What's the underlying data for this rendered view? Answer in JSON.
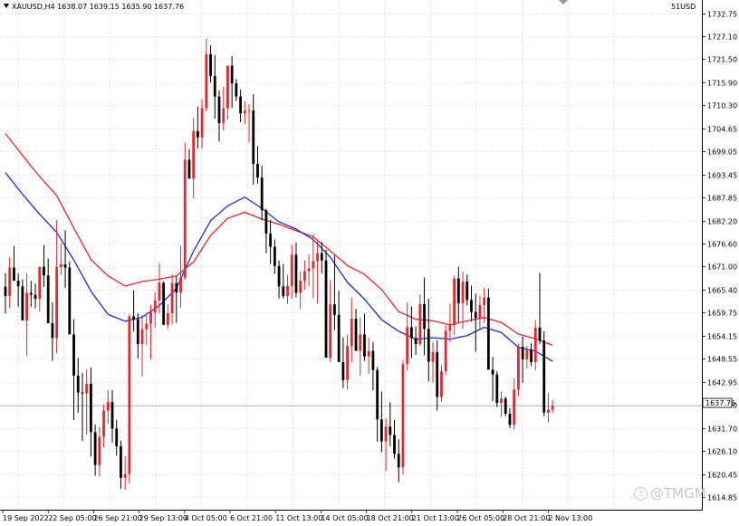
{
  "header": {
    "symbol_line": "XAUUSD,H4  1638.07 1639.15 1635.90 1637.76",
    "corner_label": "51USD"
  },
  "watermark": "@TMGM",
  "colors": {
    "up_candle": "#e8262b",
    "down_candle": "#000000",
    "ma_fast": "#1f2bd6",
    "ma_slow": "#e8262b",
    "grid": "#c8c8c8",
    "current_price_line": "#b0b0b0"
  },
  "chart_data": {
    "type": "candlestick",
    "grid": true,
    "ylim": [
      1615.0,
      1735.5
    ],
    "yticks": [
      "1732.75",
      "1727.10",
      "1721.50",
      "1715.90",
      "1710.30",
      "1704.65",
      "1699.05",
      "1693.45",
      "1687.85",
      "1682.20",
      "1676.60",
      "1671.00",
      "1665.40",
      "1659.75",
      "1654.15",
      "1648.55",
      "1642.95",
      "1637.30",
      "1631.70",
      "1626.10",
      "1620.45",
      "1614.85"
    ],
    "current_price": "1637.76",
    "xticks": [
      "19 Sep 2022",
      "22 Sep 05:00",
      "26 Sep 21:00",
      "29 Sep 13:00",
      "4 Oct 05:00",
      "6 Oct 21:00",
      "11 Oct 13:00",
      "14 Oct 05:00",
      "18 Oct 21:00",
      "21 Oct 13:00",
      "26 Oct 05:00",
      "28 Oct 21:00",
      "2 Nov 13:00"
    ],
    "candles_ohlc": [
      [
        1667.5,
        1670.9,
        1660.8,
        1665.2
      ],
      [
        1665.2,
        1674.9,
        1662.1,
        1672.3
      ],
      [
        1672.3,
        1677.7,
        1669.6,
        1669.0
      ],
      [
        1669.0,
        1670.8,
        1662.5,
        1667.6
      ],
      [
        1667.6,
        1669.3,
        1660.6,
        1659.1
      ],
      [
        1659.1,
        1670.9,
        1650.3,
        1666.0
      ],
      [
        1666.0,
        1669.0,
        1662.5,
        1665.5
      ],
      [
        1665.5,
        1668.3,
        1662.1,
        1664.5
      ],
      [
        1664.5,
        1671.4,
        1661.4,
        1672.5
      ],
      [
        1672.5,
        1677.9,
        1667.5,
        1670.3
      ],
      [
        1670.3,
        1674.6,
        1661.3,
        1658.4
      ],
      [
        1658.4,
        1663.6,
        1649.0,
        1654.7
      ],
      [
        1654.7,
        1684.2,
        1650.9,
        1672.4
      ],
      [
        1672.4,
        1678.4,
        1670.4,
        1673.1
      ],
      [
        1673.1,
        1681.6,
        1667.2,
        1672.3
      ],
      [
        1672.3,
        1673.8,
        1658.1,
        1655.6
      ],
      [
        1655.6,
        1659.4,
        1634.2,
        1645.3
      ],
      [
        1645.3,
        1649.7,
        1636.0,
        1641.1
      ],
      [
        1641.1,
        1646.0,
        1629.0,
        1640.9
      ],
      [
        1640.9,
        1646.9,
        1630.6,
        1643.3
      ],
      [
        1643.3,
        1647.3,
        1625.1,
        1631.2
      ],
      [
        1631.2,
        1633.1,
        1620.3,
        1623.0
      ],
      [
        1623.0,
        1632.5,
        1620.1,
        1630.0
      ],
      [
        1630.0,
        1638.1,
        1627.4,
        1636.6
      ],
      [
        1636.6,
        1641.7,
        1633.3,
        1638.7
      ],
      [
        1638.7,
        1641.7,
        1628.6,
        1632.1
      ],
      [
        1632.1,
        1634.3,
        1625.4,
        1627.7
      ],
      [
        1627.7,
        1629.1,
        1617.1,
        1619.8
      ],
      [
        1619.8,
        1625.2,
        1616.8,
        1620.7
      ],
      [
        1620.7,
        1660.7,
        1618.4,
        1660.1
      ],
      [
        1660.1,
        1666.6,
        1656.3,
        1659.4
      ],
      [
        1659.4,
        1660.9,
        1649.6,
        1653.2
      ],
      [
        1653.2,
        1660.4,
        1645.1,
        1656.9
      ],
      [
        1656.9,
        1661.0,
        1653.0,
        1658.3
      ],
      [
        1658.3,
        1663.0,
        1649.4,
        1661.1
      ],
      [
        1661.1,
        1666.1,
        1657.4,
        1664.1
      ],
      [
        1664.1,
        1673.5,
        1660.9,
        1668.5
      ],
      [
        1668.5,
        1668.8,
        1660.1,
        1658.0
      ],
      [
        1658.0,
        1663.2,
        1657.0,
        1660.9
      ],
      [
        1660.9,
        1670.6,
        1658.1,
        1668.4
      ],
      [
        1668.4,
        1670.1,
        1658.5,
        1666.1
      ],
      [
        1666.1,
        1677.8,
        1662.3,
        1669.8
      ],
      [
        1669.8,
        1703.5,
        1669.2,
        1699.2
      ],
      [
        1699.2,
        1701.9,
        1697.8,
        1694.5
      ],
      [
        1694.5,
        1709.6,
        1689.6,
        1706.4
      ],
      [
        1706.4,
        1712.5,
        1702.1,
        1704.8
      ],
      [
        1704.8,
        1714.3,
        1702.0,
        1712.1
      ],
      [
        1712.1,
        1729.5,
        1711.3,
        1725.6
      ],
      [
        1725.6,
        1727.8,
        1718.5,
        1720.1
      ],
      [
        1720.1,
        1725.4,
        1709.5,
        1715.0
      ],
      [
        1715.0,
        1716.6,
        1703.7,
        1708.4
      ],
      [
        1708.4,
        1717.4,
        1706.6,
        1712.1
      ],
      [
        1712.1,
        1722.1,
        1709.2,
        1722.7
      ],
      [
        1722.7,
        1725.1,
        1712.2,
        1718.3
      ],
      [
        1718.3,
        1719.4,
        1713.9,
        1715.0
      ],
      [
        1715.0,
        1716.7,
        1708.6,
        1710.8
      ],
      [
        1710.8,
        1713.8,
        1708.1,
        1711.5
      ],
      [
        1711.5,
        1713.1,
        1703.6,
        1711.5
      ],
      [
        1711.5,
        1715.6,
        1693.0,
        1698.2
      ],
      [
        1698.2,
        1702.6,
        1693.2,
        1694.8
      ],
      [
        1694.8,
        1697.8,
        1684.1,
        1686.6
      ],
      [
        1686.6,
        1687.0,
        1675.9,
        1680.8
      ],
      [
        1680.8,
        1684.2,
        1673.2,
        1677.5
      ],
      [
        1677.5,
        1679.3,
        1670.7,
        1672.7
      ],
      [
        1672.7,
        1674.1,
        1664.6,
        1667.6
      ],
      [
        1667.6,
        1673.2,
        1664.6,
        1665.2
      ],
      [
        1665.2,
        1670.5,
        1663.1,
        1667.7
      ],
      [
        1667.7,
        1678.0,
        1664.5,
        1675.5
      ],
      [
        1675.5,
        1678.5,
        1664.9,
        1666.0
      ],
      [
        1666.0,
        1671.3,
        1662.0,
        1669.0
      ],
      [
        1669.0,
        1674.1,
        1666.8,
        1671.4
      ],
      [
        1671.4,
        1675.5,
        1667.7,
        1672.1
      ],
      [
        1672.1,
        1680.6,
        1664.6,
        1673.9
      ],
      [
        1673.9,
        1678.8,
        1663.3,
        1675.9
      ],
      [
        1675.9,
        1678.7,
        1670.8,
        1674.1
      ],
      [
        1674.1,
        1676.8,
        1660.5,
        1649.8
      ],
      [
        1649.8,
        1669.2,
        1648.8,
        1663.1
      ],
      [
        1663.1,
        1675.3,
        1656.7,
        1660.5
      ],
      [
        1660.5,
        1666.5,
        1652.6,
        1648.7
      ],
      [
        1648.7,
        1654.9,
        1642.2,
        1644.2
      ],
      [
        1644.2,
        1655.5,
        1641.8,
        1652.7
      ],
      [
        1652.7,
        1664.8,
        1648.6,
        1659.5
      ],
      [
        1659.5,
        1662.0,
        1652.4,
        1651.5
      ],
      [
        1651.5,
        1659.8,
        1645.3,
        1655.6
      ],
      [
        1655.6,
        1660.8,
        1649.0,
        1650.1
      ],
      [
        1650.1,
        1654.8,
        1645.8,
        1651.5
      ],
      [
        1651.5,
        1653.7,
        1641.6,
        1646.7
      ],
      [
        1646.7,
        1647.5,
        1628.8,
        1634.4
      ],
      [
        1634.4,
        1641.3,
        1626.2,
        1628.9
      ],
      [
        1628.9,
        1634.7,
        1621.4,
        1632.6
      ],
      [
        1632.6,
        1638.7,
        1627.7,
        1630.5
      ],
      [
        1630.5,
        1634.3,
        1624.6,
        1625.8
      ],
      [
        1625.8,
        1629.4,
        1618.7,
        1622.4
      ],
      [
        1622.4,
        1649.2,
        1620.6,
        1648.2
      ],
      [
        1648.2,
        1663.6,
        1646.6,
        1657.4
      ],
      [
        1657.4,
        1662.6,
        1649.7,
        1654.7
      ],
      [
        1654.7,
        1657.6,
        1650.5,
        1653.2
      ],
      [
        1653.2,
        1665.6,
        1652.7,
        1663.2
      ],
      [
        1663.2,
        1669.8,
        1650.4,
        1657.0
      ],
      [
        1657.0,
        1664.5,
        1643.9,
        1648.8
      ],
      [
        1648.8,
        1653.6,
        1643.6,
        1651.2
      ],
      [
        1651.2,
        1654.2,
        1636.6,
        1640.0
      ],
      [
        1640.0,
        1647.9,
        1638.8,
        1646.4
      ],
      [
        1646.4,
        1657.9,
        1645.4,
        1656.5
      ],
      [
        1656.5,
        1663.3,
        1653.7,
        1657.9
      ],
      [
        1657.9,
        1670.3,
        1655.5,
        1669.6
      ],
      [
        1669.6,
        1672.5,
        1658.7,
        1663.4
      ],
      [
        1663.4,
        1671.3,
        1657.0,
        1668.8
      ],
      [
        1668.8,
        1670.6,
        1662.8,
        1664.2
      ],
      [
        1664.2,
        1667.8,
        1658.8,
        1661.2
      ],
      [
        1661.2,
        1665.8,
        1651.3,
        1659.7
      ],
      [
        1659.7,
        1665.3,
        1656.6,
        1662.9
      ],
      [
        1662.9,
        1667.3,
        1658.5,
        1664.8
      ],
      [
        1664.8,
        1667.0,
        1650.7,
        1646.8
      ],
      [
        1646.8,
        1650.0,
        1638.9,
        1645.6
      ],
      [
        1645.6,
        1646.4,
        1637.5,
        1638.5
      ],
      [
        1638.5,
        1641.3,
        1635.0,
        1639.6
      ],
      [
        1639.6,
        1640.1,
        1635.2,
        1635.8
      ],
      [
        1635.8,
        1637.2,
        1632.2,
        1633.0
      ],
      [
        1633.0,
        1644.7,
        1631.8,
        1641.8
      ],
      [
        1641.8,
        1653.3,
        1640.2,
        1652.5
      ],
      [
        1652.5,
        1655.1,
        1643.5,
        1649.4
      ],
      [
        1649.4,
        1652.8,
        1647.1,
        1651.9
      ],
      [
        1651.9,
        1653.4,
        1647.7,
        1648.7
      ],
      [
        1648.7,
        1659.2,
        1646.7,
        1657.3
      ],
      [
        1657.3,
        1671.0,
        1653.2,
        1654.1
      ],
      [
        1654.1,
        1656.4,
        1635.1,
        1636.1
      ],
      [
        1636.1,
        1641.0,
        1633.6,
        1636.8
      ],
      [
        1636.8,
        1639.2,
        1635.9,
        1637.8
      ]
    ],
    "series": [
      {
        "x_candle_index": [
          0,
          4,
          8,
          12,
          16,
          20,
          24,
          28,
          32,
          36,
          40,
          44,
          48,
          52,
          56,
          60,
          64,
          68,
          72,
          76,
          80,
          84,
          88,
          92,
          96,
          100,
          104,
          108,
          112,
          116,
          120,
          124,
          128
        ],
        "values": [
          1696.0,
          1690.6,
          1685.6,
          1681.1,
          1674.2,
          1666.4,
          1660.6,
          1658.9,
          1659.9,
          1662.8,
          1667.1,
          1676.4,
          1684.0,
          1687.7,
          1689.9,
          1687.1,
          1683.7,
          1681.9,
          1679.3,
          1674.9,
          1668.6,
          1664.4,
          1659.3,
          1656.4,
          1654.4,
          1654.8,
          1654.4,
          1655.3,
          1657.4,
          1656.1,
          1652.4,
          1651.4,
          1648.9
        ]
      },
      {
        "x_candle_index": [
          0,
          4,
          8,
          12,
          16,
          20,
          24,
          28,
          32,
          36,
          40,
          44,
          48,
          52,
          56,
          60,
          64,
          68,
          72,
          76,
          80,
          84,
          88,
          92,
          96,
          100,
          104,
          108,
          112,
          116,
          120,
          124,
          128
        ],
        "values": [
          1705.8,
          1700.3,
          1695.0,
          1690.3,
          1682.2,
          1674.3,
          1670.2,
          1667.7,
          1668.8,
          1669.4,
          1670.2,
          1673.7,
          1680.3,
          1684.6,
          1686.1,
          1684.4,
          1683.1,
          1681.5,
          1680.0,
          1676.5,
          1672.8,
          1670.6,
          1666.8,
          1661.3,
          1659.4,
          1659.0,
          1658.0,
          1659.0,
          1659.8,
          1658.6,
          1655.7,
          1654.5,
          1652.9
        ]
      }
    ]
  }
}
